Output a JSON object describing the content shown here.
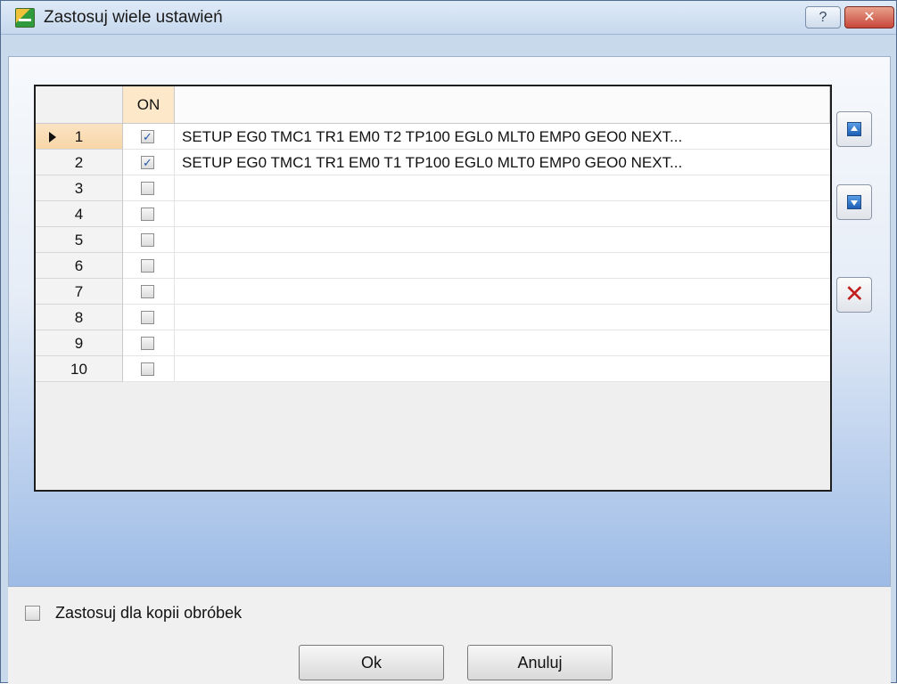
{
  "window": {
    "title": "Zastosuj wiele ustawień",
    "help_label": "?",
    "close_label": "✕"
  },
  "grid": {
    "on_header": "ON",
    "rows": [
      {
        "number": "1",
        "checked": true,
        "text": "SETUP EG0 TMC1 TR1 EM0 T2 TP100 EGL0 MLT0 EMP0 GEO0 NEXT..."
      },
      {
        "number": "2",
        "checked": true,
        "text": "SETUP EG0 TMC1 TR1 EM0 T1 TP100 EGL0 MLT0 EMP0 GEO0 NEXT..."
      },
      {
        "number": "3",
        "checked": false,
        "text": ""
      },
      {
        "number": "4",
        "checked": false,
        "text": ""
      },
      {
        "number": "5",
        "checked": false,
        "text": ""
      },
      {
        "number": "6",
        "checked": false,
        "text": ""
      },
      {
        "number": "7",
        "checked": false,
        "text": ""
      },
      {
        "number": "8",
        "checked": false,
        "text": ""
      },
      {
        "number": "9",
        "checked": false,
        "text": ""
      },
      {
        "number": "10",
        "checked": false,
        "text": ""
      }
    ],
    "active_row": "1"
  },
  "side_buttons": {
    "move_up_icon": "arrow-up-icon",
    "move_down_icon": "arrow-down-icon",
    "delete_icon": "delete-icon",
    "delete_glyph": "✕"
  },
  "options": {
    "apply_copies_label": "Zastosuj dla kopii obróbek",
    "apply_copies_checked": false
  },
  "buttons": {
    "ok": "Ok",
    "cancel": "Anuluj"
  },
  "colors": {
    "accent_header": "#fde9c9",
    "active_row": "#f7d6a8",
    "delete_red": "#c21e1e"
  }
}
